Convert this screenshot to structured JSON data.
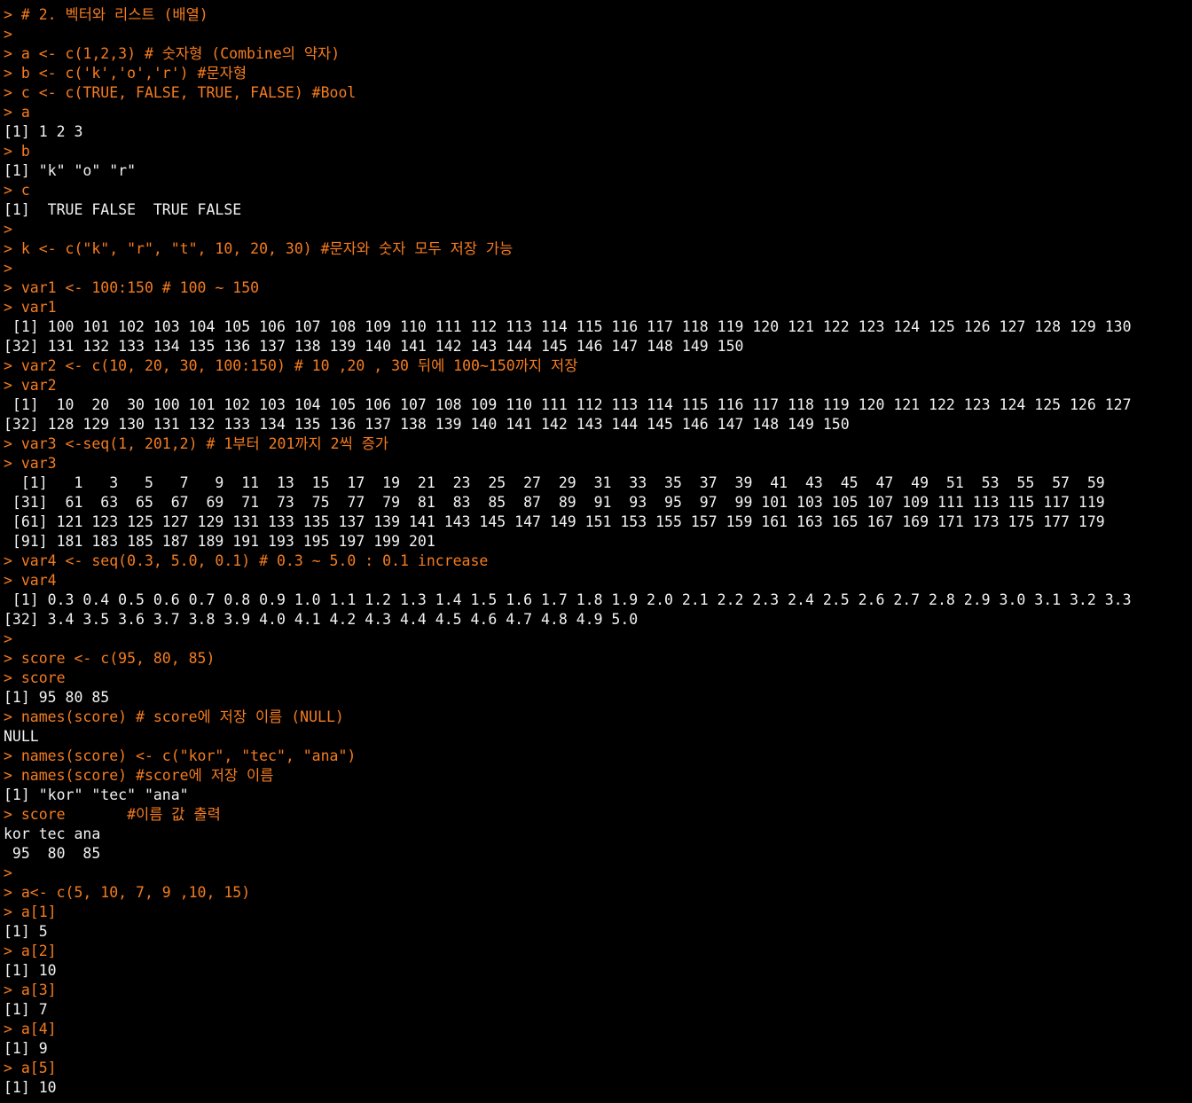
{
  "colors": {
    "background": "#000000",
    "input": "#f57c1f",
    "output": "#f2f2f2"
  },
  "console": {
    "lines": [
      {
        "kind": "in",
        "text": "> # 2. 벡터와 리스트 (배열)"
      },
      {
        "kind": "in",
        "text": ">"
      },
      {
        "kind": "in",
        "text": "> a <- c(1,2,3) # 숫자형 (Combine의 약자)"
      },
      {
        "kind": "in",
        "text": "> b <- c('k','o','r') #문자형"
      },
      {
        "kind": "in",
        "text": "> c <- c(TRUE, FALSE, TRUE, FALSE) #Bool"
      },
      {
        "kind": "in",
        "text": "> a"
      },
      {
        "kind": "out",
        "text": "[1] 1 2 3"
      },
      {
        "kind": "in",
        "text": "> b"
      },
      {
        "kind": "out",
        "text": "[1] \"k\" \"o\" \"r\""
      },
      {
        "kind": "in",
        "text": "> c"
      },
      {
        "kind": "out",
        "text": "[1]  TRUE FALSE  TRUE FALSE"
      },
      {
        "kind": "in",
        "text": ">"
      },
      {
        "kind": "in",
        "text": "> k <- c(\"k\", \"r\", \"t\", 10, 20, 30) #문자와 숫자 모두 저장 가능"
      },
      {
        "kind": "in",
        "text": ">"
      },
      {
        "kind": "in",
        "text": "> var1 <- 100:150 # 100 ~ 150"
      },
      {
        "kind": "in",
        "text": "> var1"
      },
      {
        "kind": "out",
        "text": " [1] 100 101 102 103 104 105 106 107 108 109 110 111 112 113 114 115 116 117 118 119 120 121 122 123 124 125 126 127 128 129 130"
      },
      {
        "kind": "out",
        "text": "[32] 131 132 133 134 135 136 137 138 139 140 141 142 143 144 145 146 147 148 149 150"
      },
      {
        "kind": "in",
        "text": "> var2 <- c(10, 20, 30, 100:150) # 10 ,20 , 30 뒤에 100~150까지 저장"
      },
      {
        "kind": "in",
        "text": "> var2"
      },
      {
        "kind": "out",
        "text": " [1]  10  20  30 100 101 102 103 104 105 106 107 108 109 110 111 112 113 114 115 116 117 118 119 120 121 122 123 124 125 126 127"
      },
      {
        "kind": "out",
        "text": "[32] 128 129 130 131 132 133 134 135 136 137 138 139 140 141 142 143 144 145 146 147 148 149 150"
      },
      {
        "kind": "in",
        "text": "> var3 <-seq(1, 201,2) # 1부터 201까지 2씩 증가"
      },
      {
        "kind": "in",
        "text": "> var3"
      },
      {
        "kind": "out",
        "text": "  [1]   1   3   5   7   9  11  13  15  17  19  21  23  25  27  29  31  33  35  37  39  41  43  45  47  49  51  53  55  57  59"
      },
      {
        "kind": "out",
        "text": " [31]  61  63  65  67  69  71  73  75  77  79  81  83  85  87  89  91  93  95  97  99 101 103 105 107 109 111 113 115 117 119"
      },
      {
        "kind": "out",
        "text": " [61] 121 123 125 127 129 131 133 135 137 139 141 143 145 147 149 151 153 155 157 159 161 163 165 167 169 171 173 175 177 179"
      },
      {
        "kind": "out",
        "text": " [91] 181 183 185 187 189 191 193 195 197 199 201"
      },
      {
        "kind": "in",
        "text": "> var4 <- seq(0.3, 5.0, 0.1) # 0.3 ~ 5.0 : 0.1 increase"
      },
      {
        "kind": "in",
        "text": "> var4"
      },
      {
        "kind": "out",
        "text": " [1] 0.3 0.4 0.5 0.6 0.7 0.8 0.9 1.0 1.1 1.2 1.3 1.4 1.5 1.6 1.7 1.8 1.9 2.0 2.1 2.2 2.3 2.4 2.5 2.6 2.7 2.8 2.9 3.0 3.1 3.2 3.3"
      },
      {
        "kind": "out",
        "text": "[32] 3.4 3.5 3.6 3.7 3.8 3.9 4.0 4.1 4.2 4.3 4.4 4.5 4.6 4.7 4.8 4.9 5.0"
      },
      {
        "kind": "in",
        "text": ">"
      },
      {
        "kind": "in",
        "text": "> score <- c(95, 80, 85)"
      },
      {
        "kind": "in",
        "text": "> score"
      },
      {
        "kind": "out",
        "text": "[1] 95 80 85"
      },
      {
        "kind": "in",
        "text": "> names(score) # score에 저장 이름 (NULL)"
      },
      {
        "kind": "out",
        "text": "NULL"
      },
      {
        "kind": "in",
        "text": "> names(score) <- c(\"kor\", \"tec\", \"ana\")"
      },
      {
        "kind": "in",
        "text": "> names(score) #score에 저장 이름"
      },
      {
        "kind": "out",
        "text": "[1] \"kor\" \"tec\" \"ana\""
      },
      {
        "kind": "in",
        "text": "> score       #이름 값 출력"
      },
      {
        "kind": "out",
        "text": "kor tec ana"
      },
      {
        "kind": "out",
        "text": " 95  80  85"
      },
      {
        "kind": "in",
        "text": ">"
      },
      {
        "kind": "in",
        "text": "> a<- c(5, 10, 7, 9 ,10, 15)"
      },
      {
        "kind": "in",
        "text": "> a[1]"
      },
      {
        "kind": "out",
        "text": "[1] 5"
      },
      {
        "kind": "in",
        "text": "> a[2]"
      },
      {
        "kind": "out",
        "text": "[1] 10"
      },
      {
        "kind": "in",
        "text": "> a[3]"
      },
      {
        "kind": "out",
        "text": "[1] 7"
      },
      {
        "kind": "in",
        "text": "> a[4]"
      },
      {
        "kind": "out",
        "text": "[1] 9"
      },
      {
        "kind": "in",
        "text": "> a[5]"
      },
      {
        "kind": "out",
        "text": "[1] 10"
      }
    ]
  }
}
